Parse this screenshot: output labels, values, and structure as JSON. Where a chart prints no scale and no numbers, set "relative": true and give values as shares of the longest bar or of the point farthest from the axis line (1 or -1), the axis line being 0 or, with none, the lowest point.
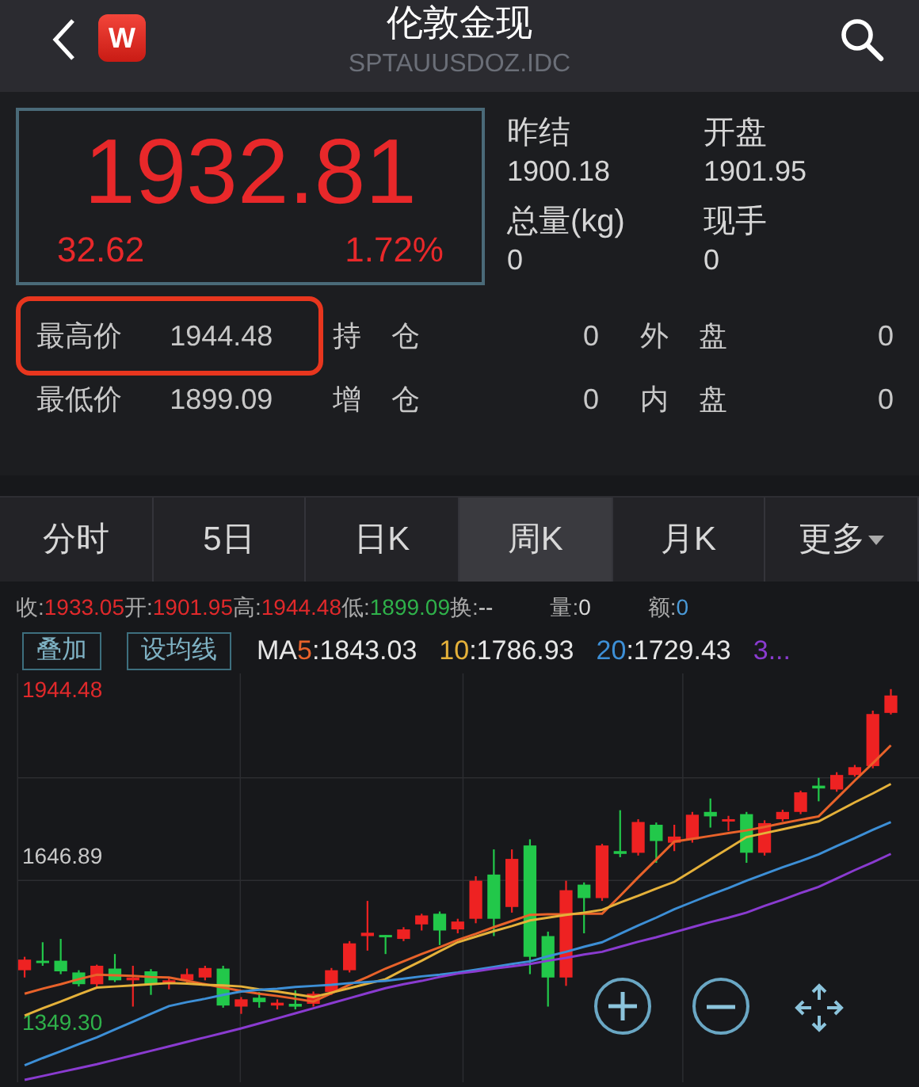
{
  "header": {
    "title": "伦敦金现",
    "subtitle": "SPTAUUSDOZ.IDC",
    "app_badge": "W"
  },
  "price": {
    "last": "1932.81",
    "change": "32.62",
    "change_pct": "1.72%"
  },
  "summary": [
    {
      "label": "昨结",
      "value": "1900.18"
    },
    {
      "label": "开盘",
      "value": "1901.95"
    },
    {
      "label": "总量(kg)",
      "value": "0"
    },
    {
      "label": "现手",
      "value": "0"
    }
  ],
  "stats": [
    {
      "label": "最高价",
      "value": "1944.48",
      "highlighted": true,
      "label_2": "持 仓",
      "value_2": "0",
      "label_3": "外 盘",
      "value_3": "0"
    },
    {
      "label": "最低价",
      "value": "1899.09",
      "highlighted": false,
      "label_2": "增 仓",
      "value_2": "0",
      "label_3": "内 盘",
      "value_3": "0"
    }
  ],
  "tabs": [
    {
      "label": "分时",
      "selected": false
    },
    {
      "label": "5日",
      "selected": false
    },
    {
      "label": "日K",
      "selected": false
    },
    {
      "label": "周K",
      "selected": true
    },
    {
      "label": "月K",
      "selected": false
    },
    {
      "label": "更多",
      "selected": false,
      "kind": "dropdown"
    }
  ],
  "quote_line": [
    {
      "label": "收:",
      "value": "1933.05",
      "color": "#e0292b"
    },
    {
      "label": "开:",
      "value": "1901.95",
      "color": "#e0292b"
    },
    {
      "label": "高:",
      "value": "1944.48",
      "color": "#e0292b"
    },
    {
      "label": "低:",
      "value": "1899.09",
      "color": "#2fb14a"
    },
    {
      "label": "换:",
      "value": "--",
      "color": "#d8d8d8"
    },
    {
      "label": "量:",
      "value": "0",
      "color": "#d8d8d8"
    },
    {
      "label": "额:",
      "value": "0",
      "color": "#4a9ad8"
    }
  ],
  "chart_buttons": [
    "叠加",
    "设均线"
  ],
  "ma": [
    {
      "prefix": "MA",
      "period": "5",
      "value": ":1843.03",
      "color": "#e8622a"
    },
    {
      "period": "10",
      "value": ":1786.93",
      "color": "#e5b13a"
    },
    {
      "period": "20",
      "value": ":1729.43",
      "color": "#3d8fd6"
    },
    {
      "period": "3...",
      "color": "#8a3bd0"
    }
  ],
  "chart_data": {
    "type": "candlestick",
    "categories": [
      null,
      null,
      null,
      null,
      null,
      null,
      null,
      null,
      null,
      null,
      null,
      null,
      null,
      null,
      null,
      null,
      null,
      null,
      null,
      null,
      null,
      null,
      null,
      null,
      null,
      null,
      null,
      null,
      null,
      null,
      null,
      null,
      null,
      null,
      null,
      null,
      null,
      null,
      null,
      null,
      null,
      null,
      null,
      null,
      null,
      null,
      null,
      null,
      null
    ],
    "ylim": [
      1241.8,
      1972.5
    ],
    "ohlc": [
      [
        1442,
        1466,
        1429,
        1461
      ],
      [
        1459,
        1492,
        1450,
        1455
      ],
      [
        1459,
        1498,
        1435,
        1440
      ],
      [
        1438,
        1442,
        1413,
        1417
      ],
      [
        1417,
        1452,
        1413,
        1450
      ],
      [
        1445,
        1471,
        1421,
        1424
      ],
      [
        1424,
        1450,
        1377,
        1429
      ],
      [
        1440,
        1444,
        1398,
        1417
      ],
      [
        1419,
        1429,
        1408,
        1424
      ],
      [
        1424,
        1445,
        1419,
        1435
      ],
      [
        1429,
        1450,
        1424,
        1446
      ],
      [
        1445,
        1450,
        1375,
        1379
      ],
      [
        1377,
        1394,
        1364,
        1390
      ],
      [
        1393,
        1403,
        1375,
        1385
      ],
      [
        1379,
        1390,
        1372,
        1384
      ],
      [
        1382,
        1406,
        1372,
        1377
      ],
      [
        1382,
        1404,
        1377,
        1400
      ],
      [
        1403,
        1446,
        1398,
        1442
      ],
      [
        1442,
        1494,
        1438,
        1490
      ],
      [
        1503,
        1566,
        1477,
        1509
      ],
      [
        1505,
        1505,
        1471,
        1501
      ],
      [
        1498,
        1519,
        1494,
        1515
      ],
      [
        1524,
        1543,
        1513,
        1540
      ],
      [
        1543,
        1547,
        1487,
        1513
      ],
      [
        1515,
        1534,
        1508,
        1529
      ],
      [
        1534,
        1610,
        1526,
        1602
      ],
      [
        1613,
        1658,
        1503,
        1534
      ],
      [
        1555,
        1658,
        1545,
        1641
      ],
      [
        1665,
        1676,
        1435,
        1466
      ],
      [
        1503,
        1511,
        1377,
        1429
      ],
      [
        1429,
        1602,
        1414,
        1585
      ],
      [
        1595,
        1599,
        1508,
        1571
      ],
      [
        1571,
        1668,
        1566,
        1665
      ],
      [
        1655,
        1728,
        1644,
        1650
      ],
      [
        1652,
        1712,
        1647,
        1707
      ],
      [
        1702,
        1706,
        1634,
        1673
      ],
      [
        1670,
        1702,
        1655,
        1681
      ],
      [
        1676,
        1725,
        1670,
        1720
      ],
      [
        1725,
        1749,
        1697,
        1717
      ],
      [
        1710,
        1718,
        1691,
        1712
      ],
      [
        1721,
        1725,
        1634,
        1652
      ],
      [
        1652,
        1710,
        1647,
        1705
      ],
      [
        1712,
        1729,
        1708,
        1725
      ],
      [
        1725,
        1763,
        1721,
        1760
      ],
      [
        1772,
        1786,
        1744,
        1767
      ],
      [
        1765,
        1796,
        1761,
        1791
      ],
      [
        1791,
        1809,
        1788,
        1805
      ],
      [
        1807,
        1906,
        1803,
        1900
      ],
      [
        1901.95,
        1944.48,
        1899.09,
        1933.05
      ]
    ],
    "yticks": [
      {
        "value": 1944.48,
        "label": "1944.48"
      },
      {
        "value": 1646.89,
        "label": "1646.89"
      },
      {
        "value": 1349.3,
        "label": "1349.30"
      }
    ]
  },
  "moving_averages": {
    "chart_data": {
      "type": "line",
      "relative": true,
      "categories": [
        null,
        null,
        null,
        null,
        null,
        null,
        null,
        null,
        null,
        null,
        null,
        null,
        null,
        null,
        null,
        null,
        null,
        null,
        null,
        null,
        null,
        null,
        null,
        null,
        null,
        null,
        null,
        null,
        null,
        null,
        null,
        null,
        null,
        null,
        null,
        null,
        null,
        null,
        null,
        null,
        null,
        null,
        null,
        null,
        null,
        null,
        null,
        null,
        null
      ],
      "ylim": [
        1241.8,
        1972.5
      ],
      "series": [
        {
          "color": "#e8622a",
          "values": [
            1400,
            1409,
            1417,
            1426,
            1434,
            1433,
            1432,
            1430,
            1429,
            1423,
            1417,
            1411,
            1405,
            1400,
            1396,
            1391,
            1386,
            1401,
            1416,
            1430,
            1445,
            1458,
            1471,
            1483,
            1496,
            1507,
            1519,
            1530,
            1541,
            1542,
            1542,
            1543,
            1543,
            1575,
            1608,
            1640,
            1672,
            1677,
            1682,
            1687,
            1692,
            1698,
            1705,
            1711,
            1717,
            1749,
            1781,
            1812,
            1844
          ]
        },
        {
          "color": "#e5b13a",
          "values": [
            1361,
            1374,
            1386,
            1399,
            1411,
            1413,
            1415,
            1417,
            1419,
            1418,
            1416,
            1415,
            1413,
            1408,
            1404,
            1399,
            1394,
            1402,
            1410,
            1418,
            1426,
            1443,
            1459,
            1476,
            1492,
            1502,
            1512,
            1521,
            1531,
            1536,
            1541,
            1545,
            1550,
            1563,
            1575,
            1588,
            1600,
            1620,
            1640,
            1660,
            1680,
            1687,
            1694,
            1701,
            1708,
            1725,
            1742,
            1758,
            1775
          ]
        },
        {
          "color": "#3d8fd6",
          "values": [
            1272,
            1285,
            1297,
            1310,
            1322,
            1336,
            1350,
            1364,
            1378,
            1385,
            1391,
            1398,
            1404,
            1407,
            1409,
            1412,
            1414,
            1416,
            1419,
            1421,
            1423,
            1427,
            1431,
            1434,
            1438,
            1443,
            1448,
            1453,
            1458,
            1467,
            1475,
            1484,
            1492,
            1507,
            1522,
            1536,
            1551,
            1564,
            1577,
            1589,
            1602,
            1614,
            1626,
            1637,
            1649,
            1664,
            1678,
            1693,
            1707
          ]
        },
        {
          "color": "#8a3bd0",
          "values": [
            1246,
            1253,
            1260,
            1267,
            1274,
            1282,
            1290,
            1298,
            1306,
            1314,
            1322,
            1330,
            1338,
            1347,
            1356,
            1365,
            1374,
            1383,
            1392,
            1401,
            1410,
            1417,
            1423,
            1430,
            1436,
            1440,
            1445,
            1449,
            1453,
            1459,
            1464,
            1470,
            1475,
            1484,
            1493,
            1501,
            1510,
            1519,
            1528,
            1536,
            1545,
            1557,
            1568,
            1580,
            1591,
            1606,
            1621,
            1635,
            1650
          ]
        }
      ]
    }
  }
}
